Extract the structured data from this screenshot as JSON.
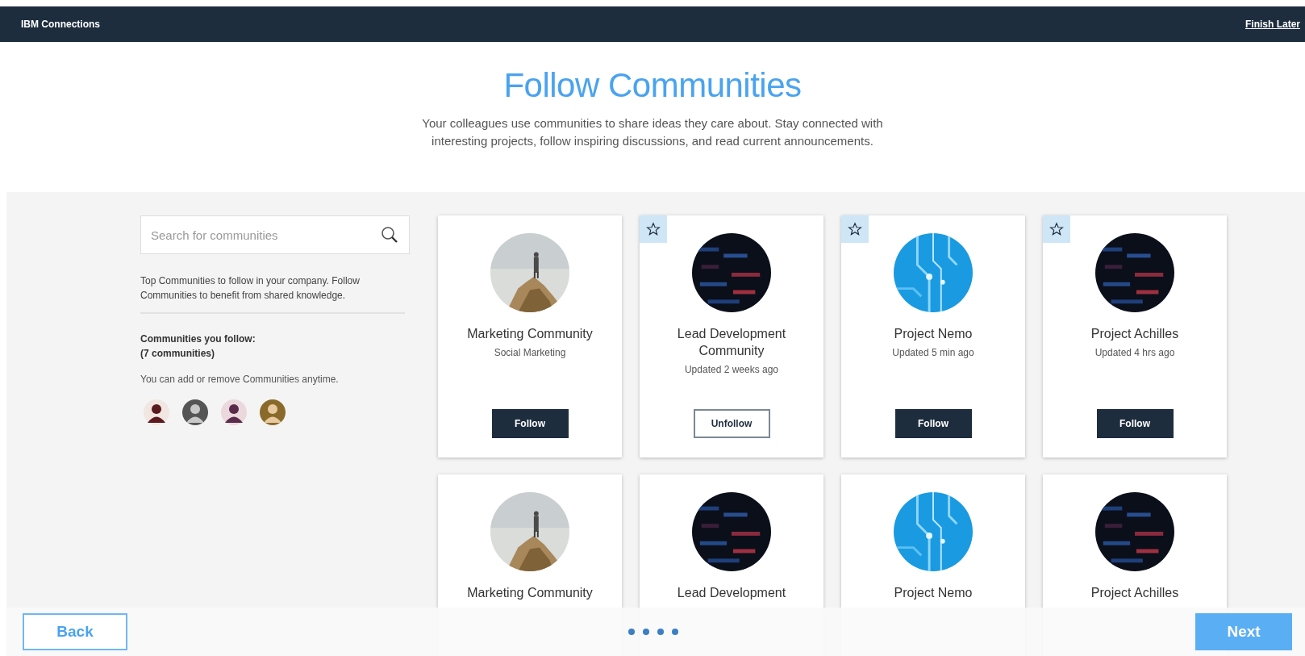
{
  "top_bar": {
    "brand": "IBM Connections",
    "finish_link": "Finish Later"
  },
  "header": {
    "title": "Follow Communities",
    "description_lines": [
      "Your colleagues use communities to share ideas they care about. Stay connected with",
      "interesting projects, follow inspiring discussions, and read current announcements."
    ]
  },
  "sidebar": {
    "search": {
      "placeholder": "Search for communities"
    },
    "intro": "Top Communities to follow in your company. Follow Communities to benefit from shared knowledge.",
    "following_heading": "Communities you follow:",
    "following_count": "(7 communities)",
    "note": "You can add or remove Communities anytime.",
    "avatars": [
      {
        "kind": "avatar"
      },
      {
        "kind": "avatar"
      },
      {
        "kind": "avatar"
      },
      {
        "kind": "avatar"
      }
    ]
  },
  "cards": [
    {
      "name": "Marketing Community",
      "subtitle": "Social Marketing",
      "starred": false,
      "button": {
        "label": "Follow",
        "following": false
      }
    },
    {
      "name": "Lead Development Community",
      "subtitle": "Updated 2 weeks ago",
      "starred": true,
      "button": {
        "label": "Unfollow",
        "following": true
      }
    },
    {
      "name": "Project Nemo",
      "subtitle": "Updated 5 min ago",
      "starred": true,
      "button": {
        "label": "Follow",
        "following": false
      }
    },
    {
      "name": "Project Achilles",
      "subtitle": "Updated 4 hrs ago",
      "starred": true,
      "button": {
        "label": "Follow",
        "following": false
      }
    },
    {
      "name": "Marketing Community",
      "starred": false
    },
    {
      "name": "Lead Development",
      "starred": false
    },
    {
      "name": "Project Nemo",
      "starred": false
    },
    {
      "name": "Project Achilles",
      "starred": false
    }
  ],
  "footer": {
    "back": "Back",
    "next": "Next",
    "page_dots": [
      {
        "kind": "dot"
      },
      {
        "kind": "dot"
      },
      {
        "kind": "dot"
      },
      {
        "kind": "dot"
      }
    ]
  }
}
